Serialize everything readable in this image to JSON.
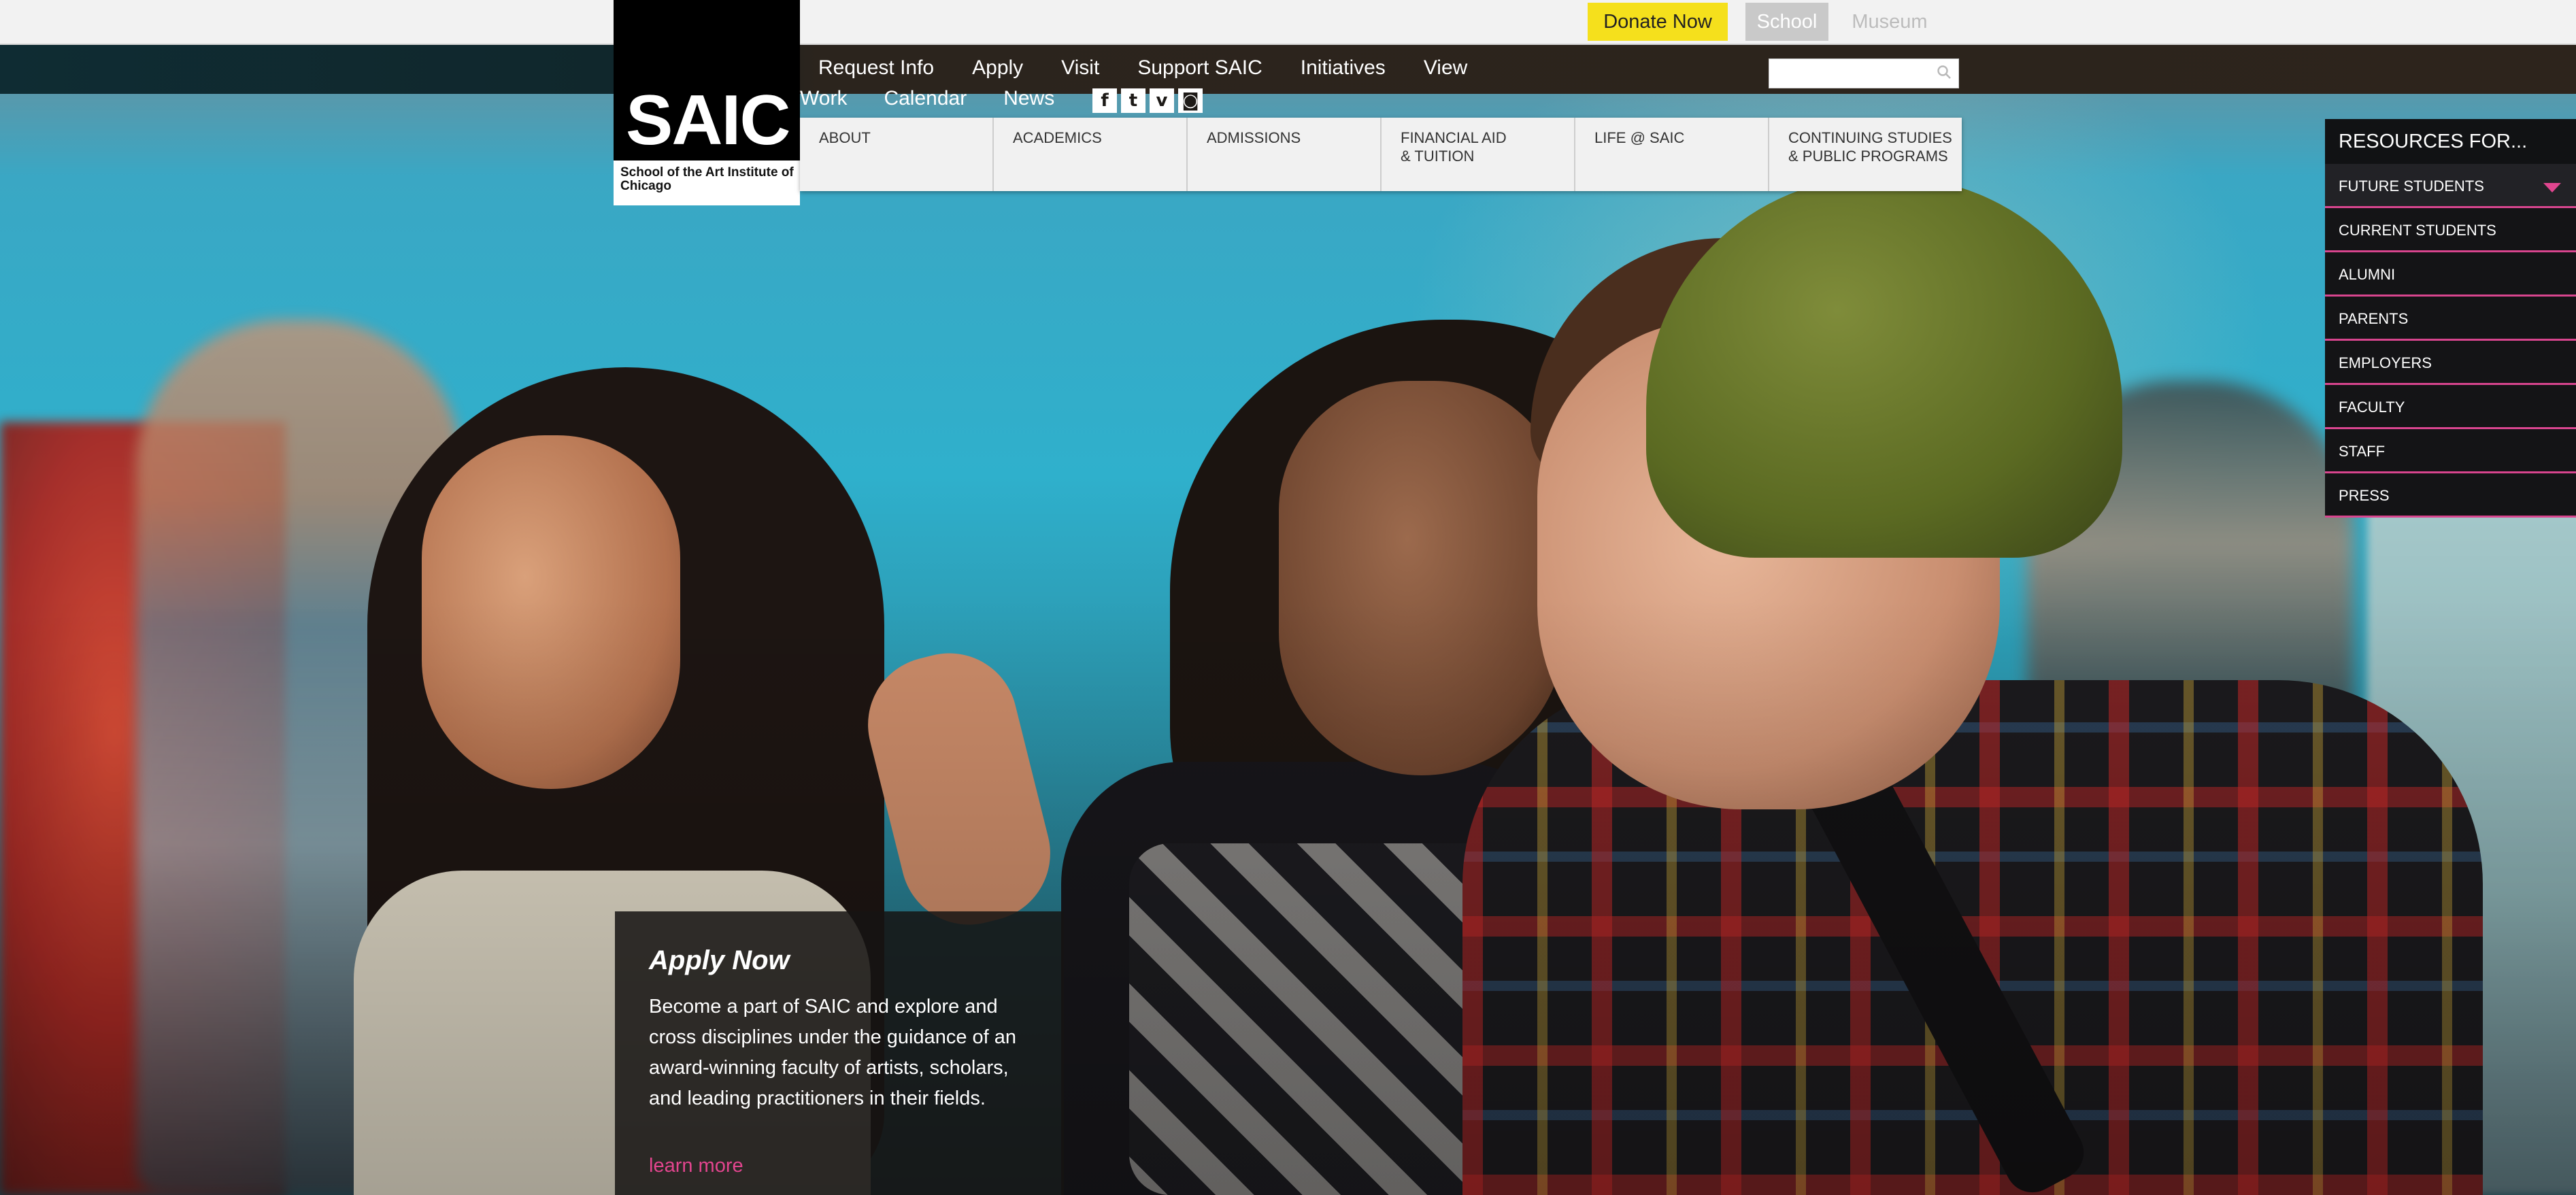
{
  "utility": {
    "donate": "Donate Now",
    "school": "School",
    "museum": "Museum"
  },
  "nav": {
    "primary": [
      "Request Info",
      "Apply",
      "Visit",
      "Support SAIC",
      "Initiatives",
      "View"
    ],
    "secondary": [
      "Work",
      "Calendar",
      "News"
    ],
    "search_placeholder": ""
  },
  "social": {
    "facebook": "f",
    "twitter": "t",
    "vimeo": "v",
    "instagram": "◙"
  },
  "logo": {
    "mark": "SAIC",
    "subtitle": "School of the Art Institute of Chicago"
  },
  "menu": [
    "ABOUT",
    "ACADEMICS",
    "ADMISSIONS",
    "FINANCIAL AID\n& TUITION",
    "LIFE @ SAIC",
    "CONTINUING STUDIES\n& PUBLIC PROGRAMS"
  ],
  "resources": {
    "title": "RESOURCES FOR...",
    "items": [
      "FUTURE STUDENTS",
      "CURRENT STUDENTS",
      "ALUMNI",
      "PARENTS",
      "EMPLOYERS",
      "FACULTY",
      "STAFF",
      "PRESS"
    ]
  },
  "apply": {
    "title": "Apply Now",
    "body": "Become a part of SAIC and explore and cross disciplines under the guidance of an award-winning faculty of artists, scholars, and leading practitioners in their fields.",
    "link": "learn more"
  },
  "colors": {
    "accent_pink": "#e3458f",
    "donate_yellow": "#f5e01c"
  }
}
